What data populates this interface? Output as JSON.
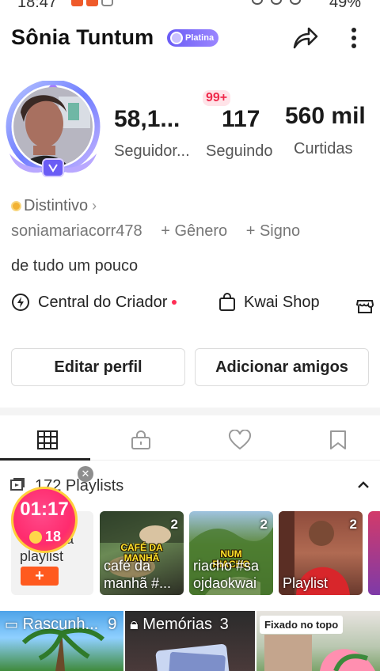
{
  "status_bar": {
    "time": "18:47",
    "battery": "49%"
  },
  "profile": {
    "name": "Sônia Tuntum",
    "badge": "Platina",
    "notification_count": "99+",
    "stats": [
      {
        "value": "58,1...",
        "label": "Seguidor..."
      },
      {
        "value": "117",
        "label": "Seguindo"
      },
      {
        "value": "560 mil",
        "label": "Curtidas"
      }
    ],
    "distintivo": "Distintivo",
    "username": "soniamariacorr478",
    "gender": "+ Gênero",
    "sign": "+ Signo",
    "bio": "de tudo um pouco"
  },
  "links": {
    "creator": "Central do Criador",
    "shop": "Kwai Shop"
  },
  "buttons": {
    "edit": "Editar perfil",
    "add_friends": "Adicionar amigos"
  },
  "tabs": [
    "posts-grid-icon",
    "lock-icon",
    "heart-icon",
    "bookmark-icon"
  ],
  "playlists": {
    "title": "172 Playlists",
    "new_card_label": "Nova\nplaylist",
    "new_card_visible": "a\nplaylist",
    "items": [
      {
        "count": "2",
        "title": "café da manhã #...",
        "stamp": "CAFÉ DA MANHÃ"
      },
      {
        "count": "2",
        "title": "riacho #sa ojdaokwai",
        "stamp": "NUM RIACHO"
      },
      {
        "count": "2",
        "title": "Playlist",
        "stamp": ""
      }
    ]
  },
  "timer": {
    "time": "01:17",
    "coins": "18"
  },
  "bottom": {
    "drafts_label": "Rascunh...",
    "drafts_count": "9",
    "memories_label": "Memórias",
    "memories_count": "3",
    "pinned_label": "Fixado no topo"
  },
  "colors": {
    "accent": "#ff5a1f",
    "badge": "#7b6cf8",
    "notification": "#ef2a4b"
  }
}
